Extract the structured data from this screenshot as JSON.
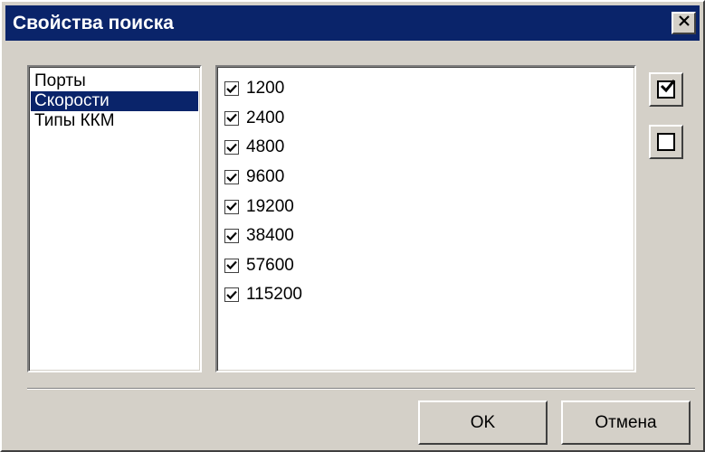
{
  "window": {
    "title": "Свойства поиска",
    "close_icon": "close-icon"
  },
  "categories": {
    "items": [
      {
        "label": "Порты",
        "selected": false
      },
      {
        "label": "Скорости",
        "selected": true
      },
      {
        "label": "Типы ККМ",
        "selected": false
      }
    ]
  },
  "speeds": {
    "items": [
      {
        "label": "1200",
        "checked": true
      },
      {
        "label": "2400",
        "checked": true
      },
      {
        "label": "4800",
        "checked": true
      },
      {
        "label": "9600",
        "checked": true
      },
      {
        "label": "19200",
        "checked": true
      },
      {
        "label": "38400",
        "checked": true
      },
      {
        "label": "57600",
        "checked": true
      },
      {
        "label": "115200",
        "checked": true
      }
    ]
  },
  "side_buttons": {
    "check_all_icon": "check-all-icon",
    "uncheck_all_icon": "uncheck-all-icon"
  },
  "buttons": {
    "ok_label": "OK",
    "cancel_label": "Отмена"
  },
  "colors": {
    "titlebar": "#0a246a",
    "selection": "#0a246a",
    "face": "#d4d0c8"
  }
}
